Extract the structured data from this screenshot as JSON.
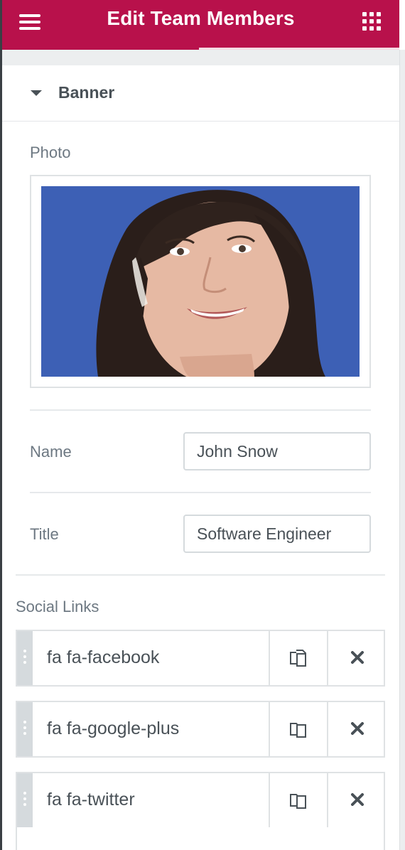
{
  "header": {
    "title": "Edit Team Members",
    "menu_icon": "hamburger-menu-icon",
    "apps_icon": "grid-apps-icon",
    "color": "#b8114b"
  },
  "section": {
    "title": "Banner",
    "expanded": true
  },
  "photo": {
    "label": "Photo"
  },
  "fields": {
    "name_label": "Name",
    "name_value": "John Snow",
    "title_label": "Title",
    "title_value": "Software Engineer"
  },
  "social": {
    "label": "Social Links",
    "items": [
      {
        "label": "fa fa-facebook"
      },
      {
        "label": "fa fa-google-plus"
      },
      {
        "label": "fa fa-twitter"
      }
    ],
    "duplicate_icon": "duplicate-icon",
    "remove_icon": "remove-x-icon"
  }
}
